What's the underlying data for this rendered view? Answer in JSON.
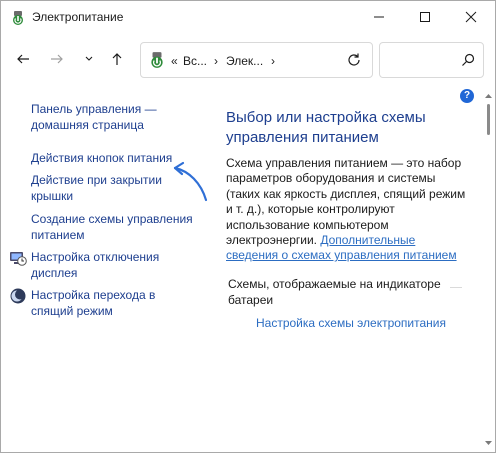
{
  "window": {
    "title": "Электропитание"
  },
  "address": {
    "prefix": "«",
    "segment1": "Вс...",
    "segment2": "Элек...",
    "separator": "›"
  },
  "sidebar": {
    "items": [
      {
        "line1": "Панель управления —",
        "line2": "домашняя страница"
      },
      {
        "line1": "Действия кнопок питания",
        "line2": ""
      },
      {
        "line1": "Действие при закрытии",
        "line2": "крышки"
      },
      {
        "line1": "Создание схемы управления",
        "line2": "питанием"
      },
      {
        "line1": "Настройка отключения",
        "line2": "дисплея",
        "icon": "monitor-clock-icon"
      },
      {
        "line1": "Настройка перехода в",
        "line2": "спящий режим",
        "icon": "moon-icon"
      }
    ]
  },
  "main": {
    "title_line1": "Выбор или настройка схемы",
    "title_line2": "управления питанием",
    "desc_lines": [
      "Схема управления питанием — это набор",
      "параметров оборудования и системы",
      "(таких как яркость дисплея, спящий режим",
      "и т. д.), которые контролируют",
      "использование компьютером",
      "электроэнергии."
    ],
    "desc_link_part1": "Дополнительные",
    "desc_link_part2": "сведения о схемах управления питанием",
    "schemes_label_line1": "Схемы, отображаемые на индикаторе",
    "schemes_label_line2": "батареи",
    "plan_settings_link": "Настройка схемы электропитания"
  },
  "help": {
    "label": "?"
  },
  "colors": {
    "link": "#1e3f8f",
    "inline_link": "#2c6dc2",
    "help_badge": "#2067d6",
    "arrow": "#2f6fd6"
  }
}
